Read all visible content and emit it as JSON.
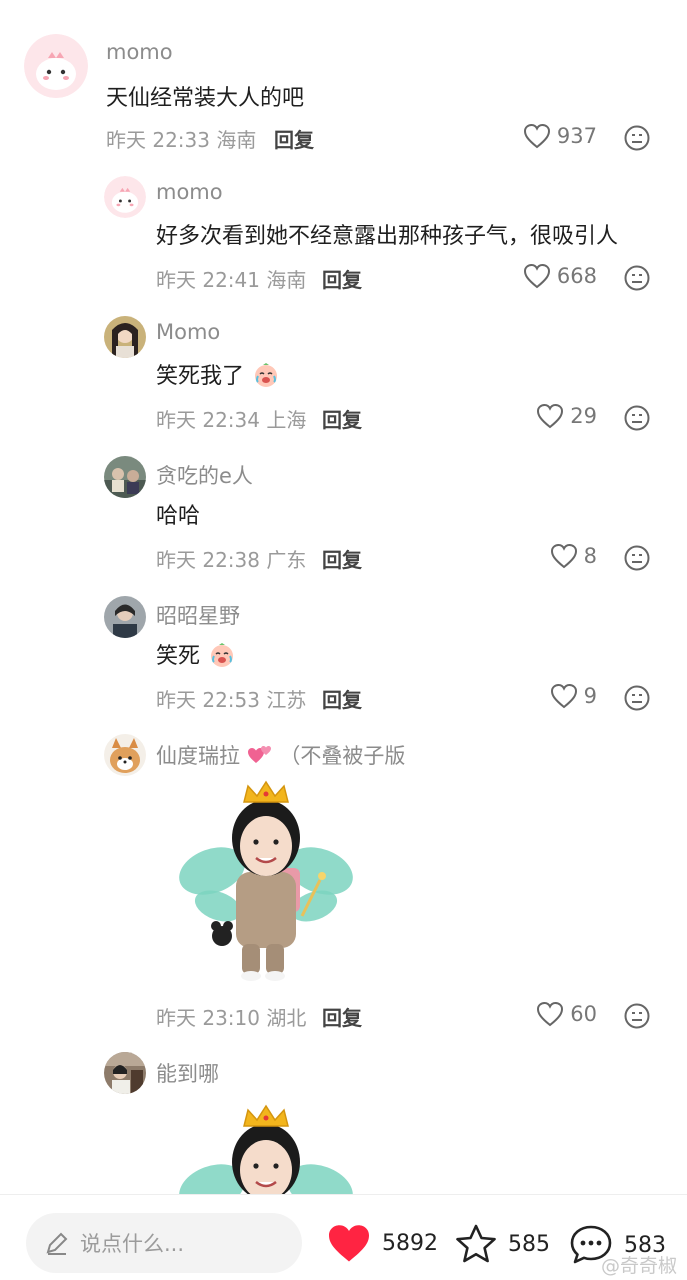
{
  "comments": [
    {
      "user": "momo",
      "text": "天仙经常装大人的吧",
      "time": "昨天 22:33",
      "location": "海南",
      "reply": "回复",
      "likes": "937"
    },
    {
      "user": "momo",
      "text": "好多次看到她不经意露出那种孩子气，很吸引人",
      "time": "昨天 22:41",
      "location": "海南",
      "reply": "回复",
      "likes": "668"
    },
    {
      "user": "Momo",
      "text": "笑死我了",
      "time": "昨天 22:34",
      "location": "上海",
      "reply": "回复",
      "likes": "29"
    },
    {
      "user": "贪吃的e人",
      "text": "哈哈",
      "time": "昨天 22:38",
      "location": "广东",
      "reply": "回复",
      "likes": "8"
    },
    {
      "user": "昭昭星野",
      "text": "笑死",
      "time": "昨天 22:53",
      "location": "江苏",
      "reply": "回复",
      "likes": "9"
    },
    {
      "user": "仙度瑞拉",
      "user_suffix": "（不叠被子版",
      "time": "昨天 23:10",
      "location": "湖北",
      "reply": "回复",
      "likes": "60"
    },
    {
      "user": "能到哪"
    }
  ],
  "bottom": {
    "placeholder": "说点什么...",
    "likes": "5892",
    "stars": "585",
    "comments": "583",
    "watermark": "@奇奇椒"
  },
  "colors": {
    "heart": "#ff2442",
    "text": "#1f1f1f",
    "meta": "#9a9a9a"
  }
}
